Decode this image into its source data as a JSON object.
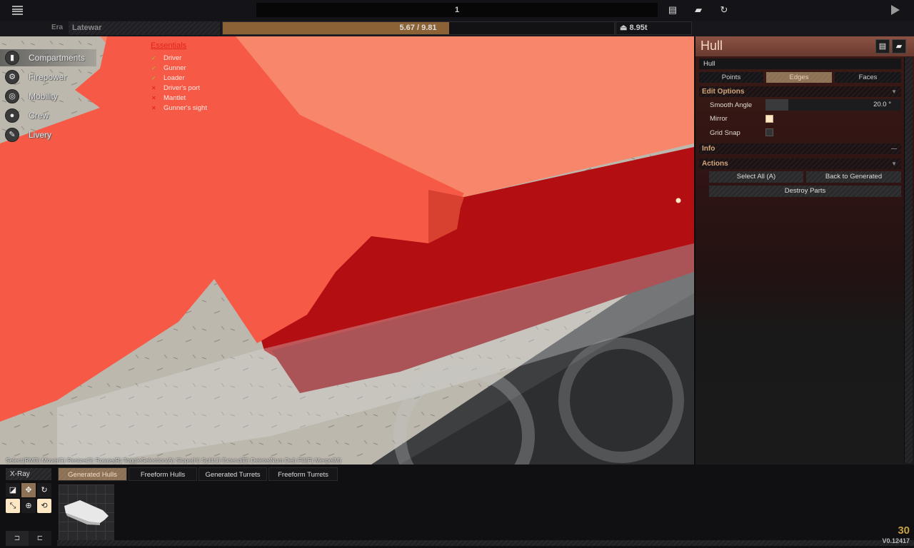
{
  "topbar": {
    "menu_icon": "hamburger-icon",
    "title_value": "1",
    "save_icon": "floppy-disk-icon",
    "load_icon": "folder-open-icon",
    "refresh_icon": "refresh-icon",
    "play_icon": "play-icon"
  },
  "infobar": {
    "era_label": "Era",
    "era_value": "Latewar",
    "budget_text": "5.67 / 9.81",
    "budget_used": 5.67,
    "budget_max": 9.81,
    "budget_color": "#8a6236",
    "weight_icon": "weight-icon",
    "weight_text": "8.95t"
  },
  "nav": {
    "items": [
      {
        "label": "Compartments",
        "icon": "compartments-icon",
        "glyph": "▮",
        "active": true
      },
      {
        "label": "Firepower",
        "icon": "firepower-icon",
        "glyph": "⚙",
        "active": false
      },
      {
        "label": "Mobility",
        "icon": "mobility-icon",
        "glyph": "◎",
        "active": false
      },
      {
        "label": "Crew",
        "icon": "crew-icon",
        "glyph": "●",
        "active": false
      },
      {
        "label": "Livery",
        "icon": "livery-icon",
        "glyph": "✎",
        "active": false
      }
    ]
  },
  "essentials": {
    "title": "Essentials",
    "items": [
      {
        "label": "Driver",
        "ok": true,
        "mark": "✓"
      },
      {
        "label": "Gunner",
        "ok": true,
        "mark": "✓"
      },
      {
        "label": "Loader",
        "ok": true,
        "mark": "✓"
      },
      {
        "label": "Driver's port",
        "ok": false,
        "mark": "✕"
      },
      {
        "label": "Mantlet",
        "ok": false,
        "mark": "✕"
      },
      {
        "label": "Gunner's sight",
        "ok": false,
        "mark": "✕"
      }
    ]
  },
  "hint": "Select(RMB) Move(G) Resize(S) Rotate(R) ToggleSelection(A) Slope(H) Split(J) Extend(E) Delete(Num Del) Fill(F) Merge(M)",
  "panel": {
    "title": "Hull",
    "save_icon": "floppy-disk-icon",
    "load_icon": "folder-open-icon",
    "name_value": "Hull",
    "mode_tabs": [
      {
        "label": "Points",
        "active": false
      },
      {
        "label": "Edges",
        "active": true
      },
      {
        "label": "Faces",
        "active": false
      }
    ],
    "edit_options": {
      "title": "Edit Options",
      "arrow": "▼",
      "smooth_angle_label": "Smooth Angle",
      "smooth_angle_value": "20.0 °",
      "smooth_angle_fraction": 0.17,
      "mirror_label": "Mirror",
      "mirror_checked": true,
      "grid_snap_label": "Grid Snap",
      "grid_snap_checked": false
    },
    "info": {
      "title": "Info",
      "arrow": "—"
    },
    "actions": {
      "title": "Actions",
      "arrow": "▼",
      "select_all": "Select All (A)",
      "back_to_generated": "Back to Generated",
      "destroy_parts": "Destroy Parts"
    }
  },
  "bottom": {
    "xray_label": "X-Ray",
    "tabs": [
      {
        "label": "Generated Hulls",
        "active": true
      },
      {
        "label": "Freeform Hulls",
        "active": false
      },
      {
        "label": "Generated Turrets",
        "active": false
      },
      {
        "label": "Freeform Turrets",
        "active": false
      }
    ],
    "tools": [
      {
        "name": "scale-tool-icon",
        "glyph": "◪",
        "state": "normal"
      },
      {
        "name": "move-tool-icon",
        "glyph": "✥",
        "state": "sel"
      },
      {
        "name": "rotate-tool-icon",
        "glyph": "↻",
        "state": "normal"
      },
      {
        "name": "snap-tool-icon",
        "glyph": "⤡",
        "state": "on"
      },
      {
        "name": "globe-tool-icon",
        "glyph": "⊕",
        "state": "normal"
      },
      {
        "name": "orbit-tool-icon",
        "glyph": "⟲",
        "state": "on"
      }
    ],
    "undo_icon": "undo-icon",
    "redo_icon": "redo-icon",
    "undo_glyph": "⊐",
    "redo_glyph": "⊏",
    "thumbnail": "hull-part-thumbnail",
    "fps": "30",
    "version": "V0.12417"
  }
}
